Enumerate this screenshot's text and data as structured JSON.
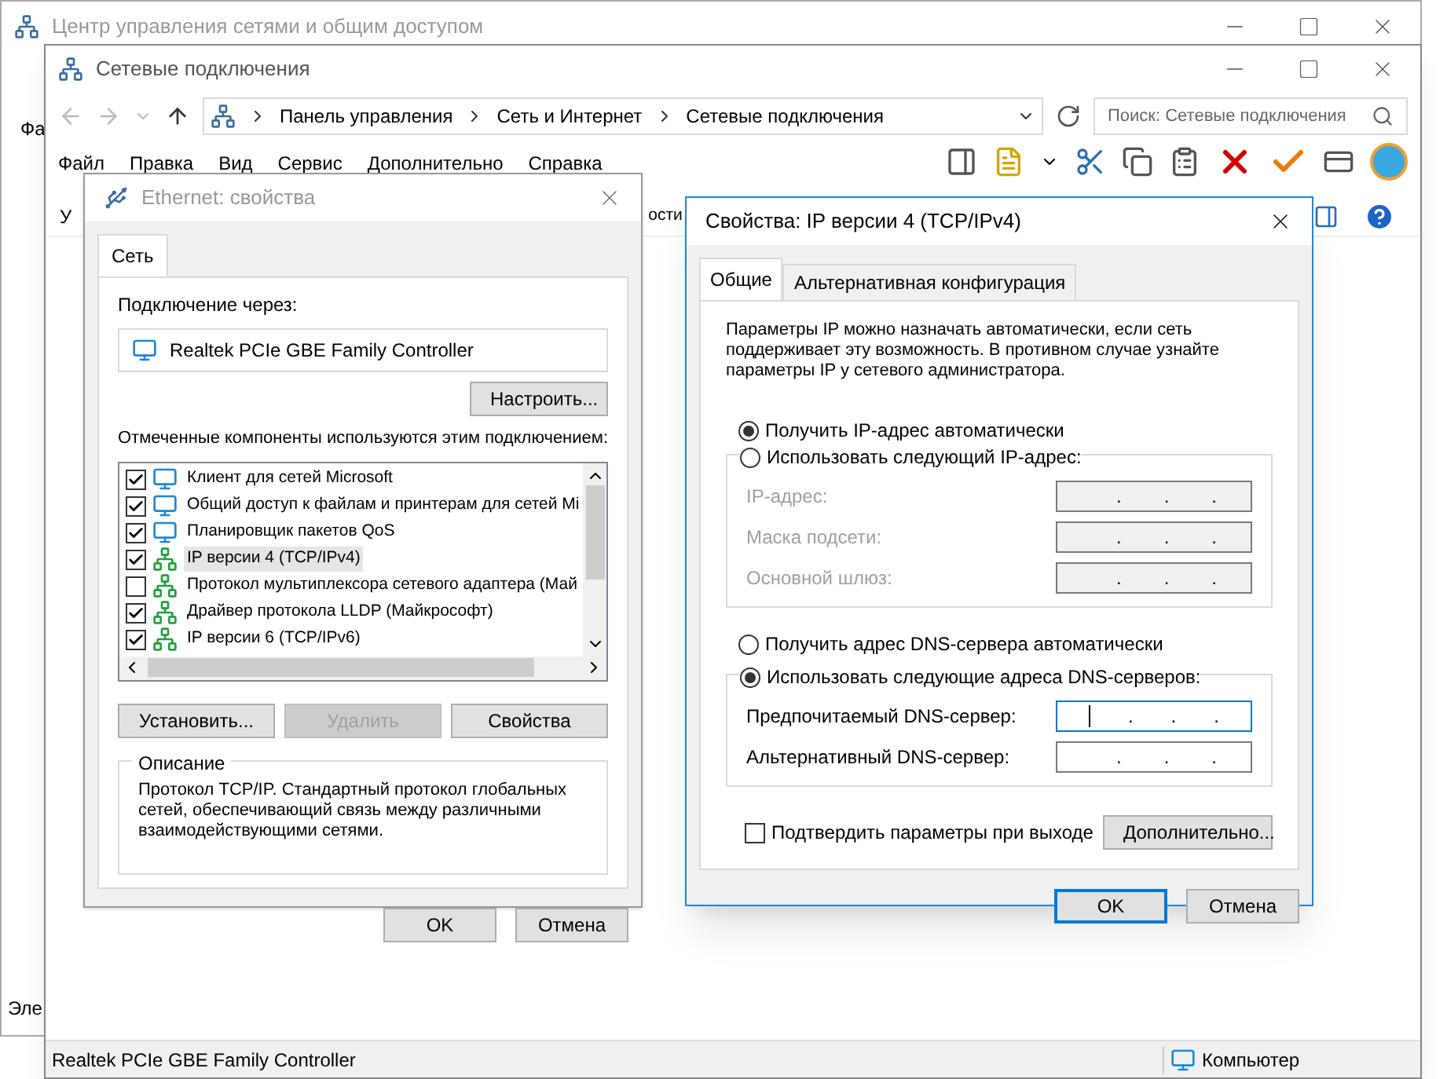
{
  "back_window": {
    "title": "Центр управления сетями и общим доступом",
    "menu_fragment": "Фа",
    "footer_fragment": "Эле"
  },
  "window": {
    "title": "Сетевые подключения",
    "breadcrumb": [
      "Панель управления",
      "Сеть и Интернет",
      "Сетевые подключения"
    ],
    "search": {
      "placeholder": "Поиск: Сетевые подключения"
    },
    "menu": [
      "Файл",
      "Правка",
      "Вид",
      "Сервис",
      "Дополнительно",
      "Справка"
    ],
    "command_fragments": [
      "У",
      "ости"
    ],
    "status_bar": {
      "device": "Realtek PCIe GBE Family Controller",
      "location": "Компьютер"
    }
  },
  "ethernet_dialog": {
    "title": "Ethernet: свойства",
    "tabs": [
      {
        "label": "Сеть",
        "selected": true
      }
    ],
    "connect_label": "Подключение через:",
    "adapter": "Realtek PCIe GBE Family Controller",
    "configure_button": "Настроить...",
    "components_label": "Отмеченные компоненты используются этим подключением:",
    "components": [
      {
        "name": "Клиент для сетей Microsoft",
        "kind": "client",
        "checked": true,
        "selected": false
      },
      {
        "name": "Общий доступ к файлам и принтерам для сетей Mi",
        "kind": "client",
        "checked": true,
        "selected": false
      },
      {
        "name": "Планировщик пакетов QoS",
        "kind": "client",
        "checked": true,
        "selected": false
      },
      {
        "name": "IP версии 4 (TCP/IPv4)",
        "kind": "protocol",
        "checked": true,
        "selected": true
      },
      {
        "name": "Протокол мультиплексора сетевого адаптера (Май",
        "kind": "protocol",
        "checked": false,
        "selected": false
      },
      {
        "name": "Драйвер протокола LLDP (Майкрософт)",
        "kind": "protocol",
        "checked": true,
        "selected": false
      },
      {
        "name": "IP версии 6 (TCP/IPv6)",
        "kind": "protocol",
        "checked": true,
        "selected": false
      }
    ],
    "buttons": [
      {
        "label": "Установить...",
        "disabled": false
      },
      {
        "label": "Удалить",
        "disabled": true
      },
      {
        "label": "Свойства",
        "disabled": false
      }
    ],
    "description": {
      "title": "Описание",
      "text": "Протокол TCP/IP. Стандартный протокол глобальных сетей, обеспечивающий связь между различными взаимодействующими сетями."
    },
    "ok": "OK",
    "cancel": "Отмена"
  },
  "ipv4_dialog": {
    "title": "Свойства: IP версии 4 (TCP/IPv4)",
    "tabs": [
      {
        "label": "Общие",
        "selected": true
      },
      {
        "label": "Альтернативная конфигурация",
        "selected": false
      }
    ],
    "intro": "Параметры IP можно назначать автоматически, если сеть поддерживает эту возможность. В противном случае узнайте параметры IP у сетевого администратора.",
    "ip_auto": {
      "label": "Получить IP-адрес автоматически",
      "selected": true
    },
    "ip_manual": {
      "label": "Использовать следующий IP-адрес:",
      "selected": false
    },
    "ip_fields": [
      {
        "label": "IP-адрес:",
        "separators": [
          ".",
          ".",
          "."
        ],
        "disabled": true,
        "focused": false
      },
      {
        "label": "Маска подсети:",
        "separators": [
          ".",
          ".",
          "."
        ],
        "disabled": true,
        "focused": false
      },
      {
        "label": "Основной шлюз:",
        "separators": [
          ".",
          ".",
          "."
        ],
        "disabled": true,
        "focused": false
      }
    ],
    "dns_auto": {
      "label": "Получить адрес DNS-сервера автоматически",
      "selected": false
    },
    "dns_manual": {
      "label": "Использовать следующие адреса DNS-серверов:",
      "selected": true
    },
    "dns_fields": [
      {
        "label": "Предпочитаемый DNS-сервер:",
        "separators": [
          ".",
          ".",
          "."
        ],
        "disabled": false,
        "focused": true
      },
      {
        "label": "Альтернативный DNS-сервер:",
        "separators": [
          ".",
          ".",
          "."
        ],
        "disabled": false,
        "focused": false
      }
    ],
    "validate": {
      "label": "Подтвердить параметры при выходе",
      "checked": false
    },
    "advanced_button": "Дополнительно...",
    "ok": "OK",
    "cancel": "Отмена"
  }
}
